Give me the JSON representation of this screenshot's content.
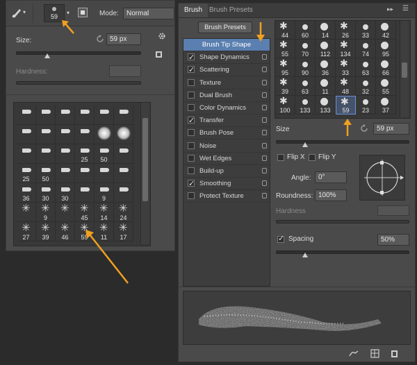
{
  "left": {
    "optbar": {
      "brush_size": "59",
      "mode_label": "Mode:",
      "mode_value": "Normal"
    },
    "size_label": "Size:",
    "size_value": "59 px",
    "hardness_label": "Hardness:",
    "size_level": 0.25,
    "presets": [
      {
        "l": ""
      },
      {
        "l": ""
      },
      {
        "l": ""
      },
      {
        "l": ""
      },
      {
        "l": ""
      },
      {
        "l": ""
      },
      {
        "l": ""
      },
      {
        "l": ""
      },
      {
        "l": ""
      },
      {
        "l": ""
      },
      {
        "l": ""
      },
      {
        "l": ""
      },
      {
        "l": ""
      },
      {
        "l": ""
      },
      {
        "l": ""
      },
      {
        "l": "25"
      },
      {
        "l": "50"
      },
      {
        "l": ""
      },
      {
        "l": "25"
      },
      {
        "l": "50"
      },
      {
        "l": ""
      },
      {
        "l": ""
      },
      {
        "l": ""
      },
      {
        "l": ""
      },
      {
        "l": "36"
      },
      {
        "l": "30"
      },
      {
        "l": "30"
      },
      {
        "l": ""
      },
      {
        "l": "9"
      },
      {
        "l": ""
      },
      {
        "l": ""
      },
      {
        "l": "9"
      },
      {
        "l": ""
      },
      {
        "l": "45"
      },
      {
        "l": "14"
      },
      {
        "l": "24"
      },
      {
        "l": "27"
      },
      {
        "l": "39"
      },
      {
        "l": "46"
      },
      {
        "l": "59"
      },
      {
        "l": "11"
      },
      {
        "l": "17"
      }
    ]
  },
  "right": {
    "tabs": [
      "Brush",
      "Brush Presets"
    ],
    "presets_button": "Brush Presets",
    "options": [
      {
        "label": "Brush Tip Shape",
        "checked": false,
        "selected": true
      },
      {
        "label": "Shape Dynamics",
        "checked": true
      },
      {
        "label": "Scattering",
        "checked": true
      },
      {
        "label": "Texture",
        "checked": false
      },
      {
        "label": "Dual Brush",
        "checked": false
      },
      {
        "label": "Color Dynamics",
        "checked": false
      },
      {
        "label": "Transfer",
        "checked": true
      },
      {
        "label": "Brush Pose",
        "checked": false
      },
      {
        "label": "Noise",
        "checked": false
      },
      {
        "label": "Wet Edges",
        "checked": false
      },
      {
        "label": "Build-up",
        "checked": false
      },
      {
        "label": "Smoothing",
        "checked": true
      },
      {
        "label": "Protect Texture",
        "checked": false
      }
    ],
    "tip_labels": [
      "44",
      "60",
      "14",
      "26",
      "33",
      "42",
      "55",
      "70",
      "112",
      "134",
      "74",
      "95",
      "95",
      "90",
      "36",
      "33",
      "63",
      "66",
      "39",
      "63",
      "11",
      "48",
      "32",
      "55",
      "100",
      "133",
      "133",
      "59",
      "23",
      "37"
    ],
    "size_label": "Size",
    "size_value": "59 px",
    "flip_x": "Flip X",
    "flip_y": "Flip Y",
    "angle_label": "Angle:",
    "angle_value": "0°",
    "roundness_label": "Roundness:",
    "roundness_value": "100%",
    "hardness_label": "Hardness",
    "spacing_label": "Spacing",
    "spacing_value": "50%",
    "spacing_checked": true,
    "size_level": 0.22,
    "spacing_level": 0.22
  },
  "colors": {
    "accent": "#f0a020",
    "selection": "#5a7fb0",
    "panel": "#4a4a4a"
  }
}
